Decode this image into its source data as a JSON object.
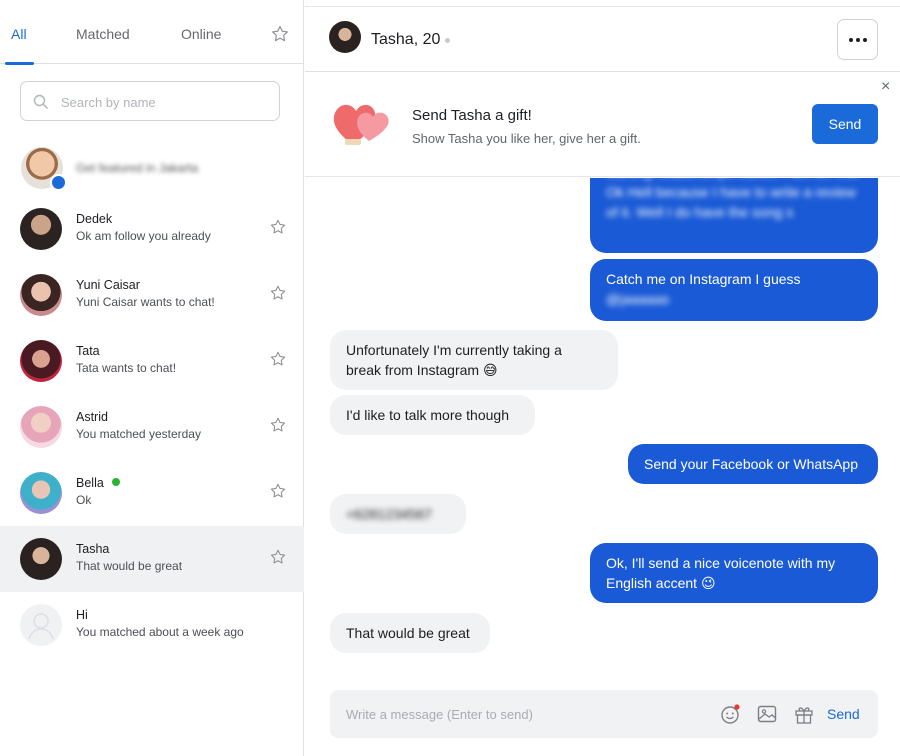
{
  "tabs": {
    "all": "All",
    "matched": "Matched",
    "online": "Online"
  },
  "search": {
    "placeholder": "Search by name"
  },
  "featured": {
    "text": "Get featured in Jakarta"
  },
  "contacts": [
    {
      "name": "Dedek",
      "preview": "Ok am follow you already",
      "online": false,
      "selected": false
    },
    {
      "name": "Yuni Caisar",
      "preview": "Yuni Caisar wants to chat!",
      "online": false,
      "selected": false
    },
    {
      "name": "Tata",
      "preview": "Tata wants to chat!",
      "online": false,
      "selected": false
    },
    {
      "name": "Astrid",
      "preview": "You matched yesterday",
      "online": false,
      "selected": false
    },
    {
      "name": "Bella",
      "preview": "Ok",
      "online": true,
      "selected": false
    },
    {
      "name": "Tasha",
      "preview": "That would be great",
      "online": false,
      "selected": true
    },
    {
      "name": "Hi",
      "preview": "You matched about a week ago",
      "online": false,
      "selected": false
    }
  ],
  "chat_header": {
    "title": "Tasha, 20"
  },
  "gift_banner": {
    "title": "Send Tasha a gift!",
    "subtitle": "Show Tasha you like her, give her a gift.",
    "button": "Send",
    "close": "×"
  },
  "messages": [
    {
      "dir": "out",
      "text": "starting relationships earlier. I am on Viet Ok Hell because I have to write a review of it. Well I do have the song s",
      "blurred": true
    },
    {
      "dir": "out",
      "text": "Catch me on Instagram I guess",
      "line2": "@jaaaaas",
      "blurred_line2": true
    },
    {
      "dir": "in",
      "text": "Unfortunately I'm currently taking a",
      "line2": "break from Instagram 😅"
    },
    {
      "dir": "in",
      "text": "I'd like to talk more though"
    },
    {
      "dir": "out",
      "text": "Send your Facebook or WhatsApp"
    },
    {
      "dir": "in",
      "text": "+6281234567",
      "blurred": true
    },
    {
      "dir": "out",
      "text": "Ok, I'll send a nice voicenote with my",
      "line2": "English accent 😉"
    },
    {
      "dir": "in",
      "text": "That would be great"
    }
  ],
  "composer": {
    "placeholder": "Write a message (Enter to send)",
    "send": "Send"
  },
  "colors": {
    "accent": "#1a6ad9",
    "outgoing_bubble": "#1a5ad6",
    "incoming_bubble": "#f1f2f4",
    "online": "#2ab530"
  }
}
